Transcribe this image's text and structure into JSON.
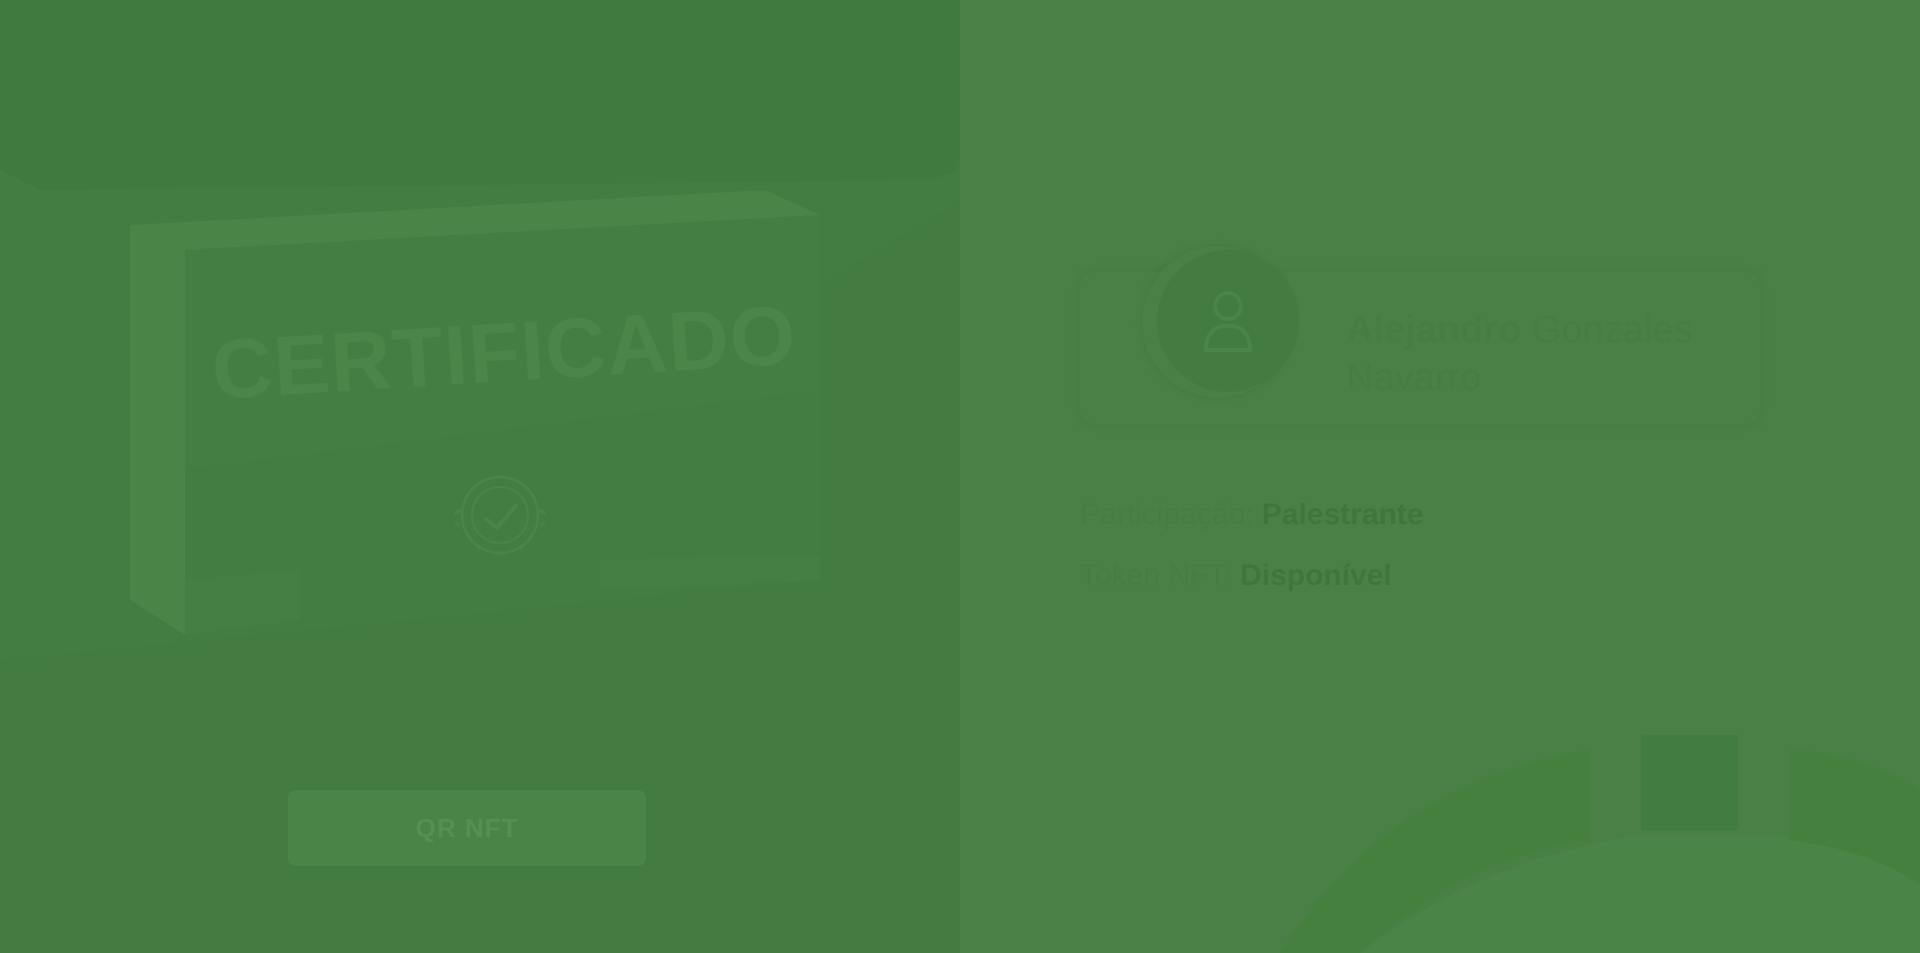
{
  "certificate": {
    "title": "CERTIFICADO",
    "button_label": "QR NFT",
    "seal_icon": "seal-icon"
  },
  "profile": {
    "first_name": "Alejandro",
    "last_name": "Gonzales Navarro",
    "avatar_icon": "user-icon"
  },
  "details": {
    "participation_label": "Participação:",
    "participation_value": "Palestrante",
    "token_label": "Token NFT:",
    "token_value": "Disponível"
  },
  "colors": {
    "background": "#437b40",
    "right_panel": "#4a8046",
    "text_dark": "#3f763c"
  }
}
